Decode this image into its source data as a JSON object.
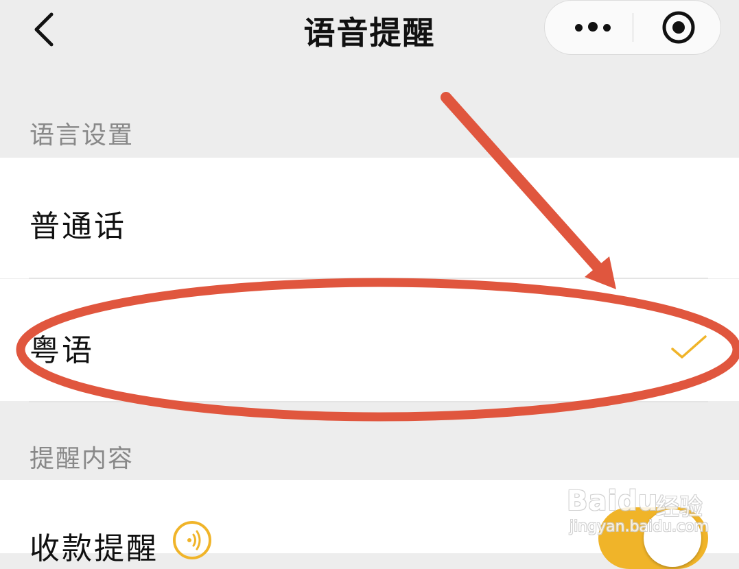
{
  "nav": {
    "title": "语音提醒",
    "back_icon": "chevron-left-icon",
    "more_icon": "more-dots-icon",
    "target_icon": "target-circle-icon"
  },
  "language_settings": {
    "header": "语言设置",
    "options": [
      {
        "label": "普通话",
        "selected": false
      },
      {
        "label": "粤语",
        "selected": true
      }
    ]
  },
  "reminder_content": {
    "header": "提醒内容",
    "items": [
      {
        "label": "收款提醒",
        "icon": "sound-wave-icon",
        "toggle_on": true
      }
    ]
  },
  "colors": {
    "accent": "#f0b429",
    "annotation": "#e0563e",
    "background": "#ededed"
  },
  "watermark": {
    "brand": "Baidu",
    "suffix": "经验",
    "url": "jingyan.baidu.com"
  }
}
